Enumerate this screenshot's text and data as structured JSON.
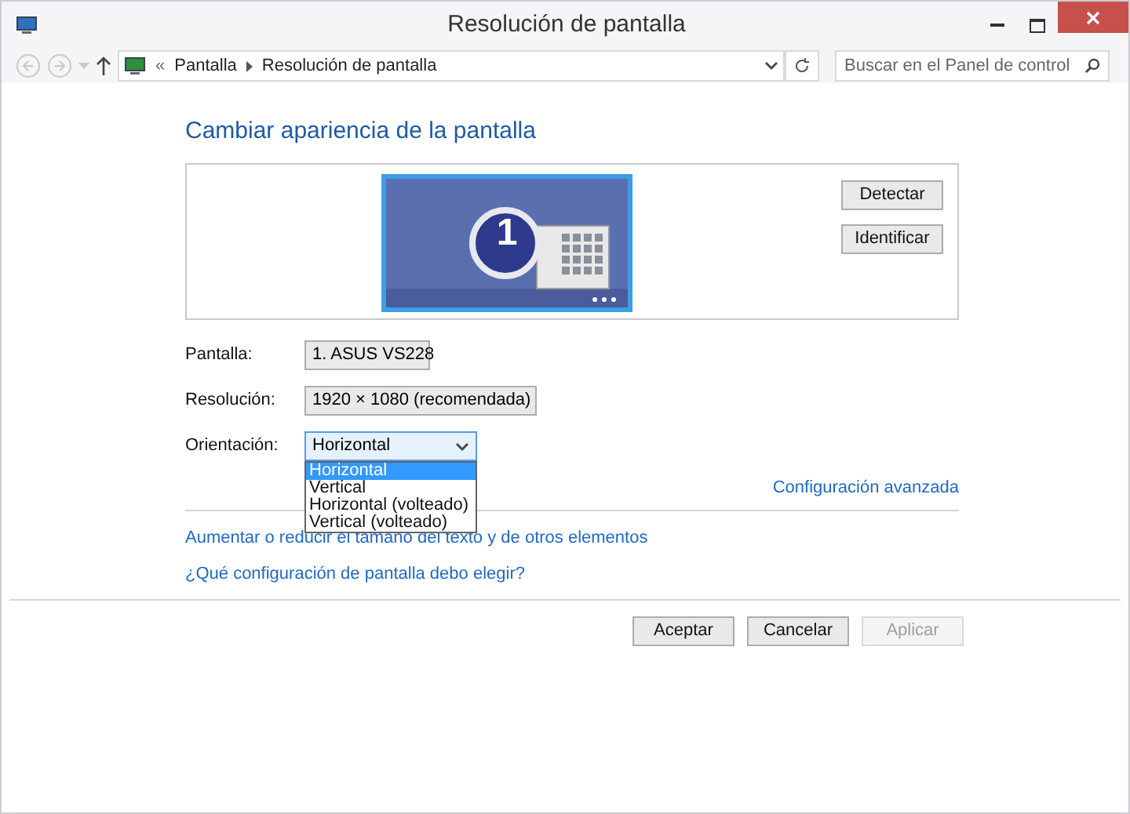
{
  "window": {
    "title": "Resolución de pantalla"
  },
  "address_bar": {
    "overflow": "«",
    "breadcrumbs": [
      "Pantalla",
      "Resolución de pantalla"
    ]
  },
  "search": {
    "placeholder": "Buscar en el Panel de control"
  },
  "heading": "Cambiar apariencia de la pantalla",
  "monitor": {
    "number": "1"
  },
  "side_buttons": [
    {
      "label": "Detectar",
      "disabled": false
    },
    {
      "label": "Identificar",
      "disabled": false
    }
  ],
  "fields": [
    {
      "label": "Pantalla:",
      "value": "1. ASUS VS228",
      "expanded": false
    },
    {
      "label": "Resolución:",
      "value": "1920 × 1080 (recomendada)",
      "expanded": false
    },
    {
      "label": "Orientación:",
      "value": "Horizontal",
      "expanded": true,
      "options": [
        {
          "label": "Horizontal",
          "selected": true
        },
        {
          "label": "Vertical",
          "selected": false
        },
        {
          "label": "Horizontal (volteado)",
          "selected": false
        },
        {
          "label": "Vertical (volteado)",
          "selected": false
        }
      ]
    }
  ],
  "advanced_link": "Configuración avanzada",
  "links": [
    "Aumentar o reducir el tamaño del texto y de otros elementos",
    "¿Qué configuración de pantalla debo elegir?"
  ],
  "buttons": [
    {
      "label": "Aceptar",
      "disabled": false
    },
    {
      "label": "Cancelar",
      "disabled": false
    },
    {
      "label": "Aplicar",
      "disabled": true
    }
  ]
}
